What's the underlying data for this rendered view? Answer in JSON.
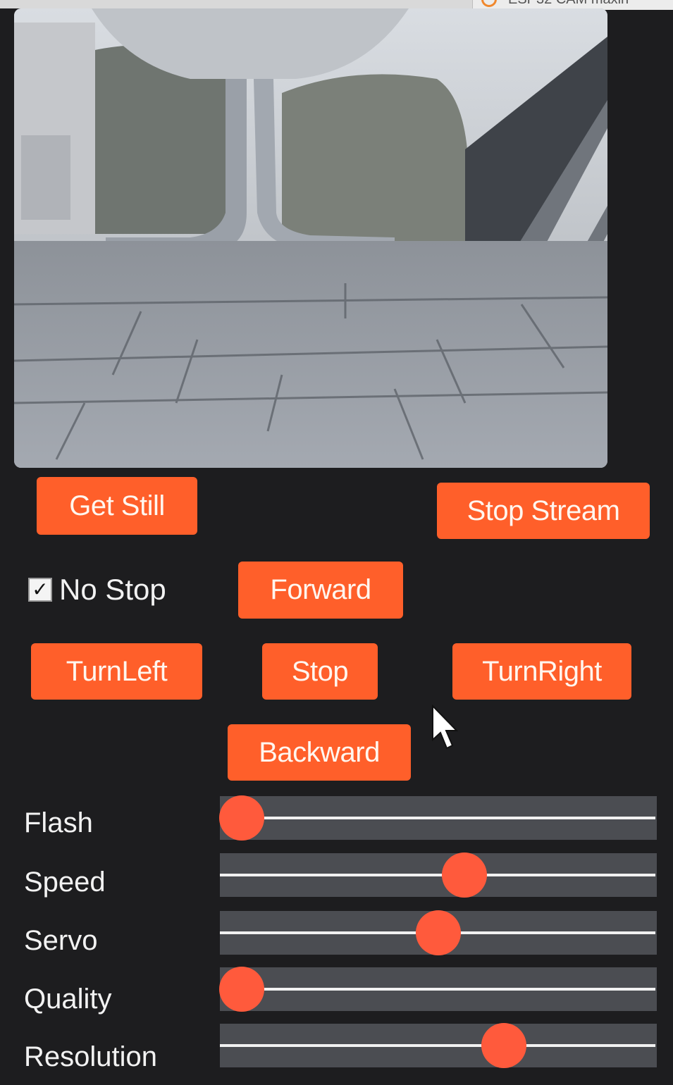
{
  "browser_tab": {
    "title": "ESP32 CAM maxin"
  },
  "camera": {
    "alt": "camera stream"
  },
  "buttons": {
    "get_still": "Get Still",
    "stop_stream": "Stop Stream",
    "forward": "Forward",
    "turn_left": "TurnLeft",
    "stop": "Stop",
    "turn_right": "TurnRight",
    "backward": "Backward"
  },
  "no_stop": {
    "label": "No Stop",
    "checked": true
  },
  "sliders": [
    {
      "label": "Flash",
      "value": 0.05
    },
    {
      "label": "Speed",
      "value": 0.56
    },
    {
      "label": "Servo",
      "value": 0.5
    },
    {
      "label": "Quality",
      "value": 0.05
    },
    {
      "label": "Resolution",
      "value": 0.65
    }
  ],
  "colors": {
    "accent": "#ff5f2a",
    "thumb": "#ff5a3c",
    "background": "#1d1d1f",
    "track": "#4b4d52"
  },
  "icons": {
    "checkbox": "check-icon",
    "cursor": "mouse-pointer-icon"
  }
}
